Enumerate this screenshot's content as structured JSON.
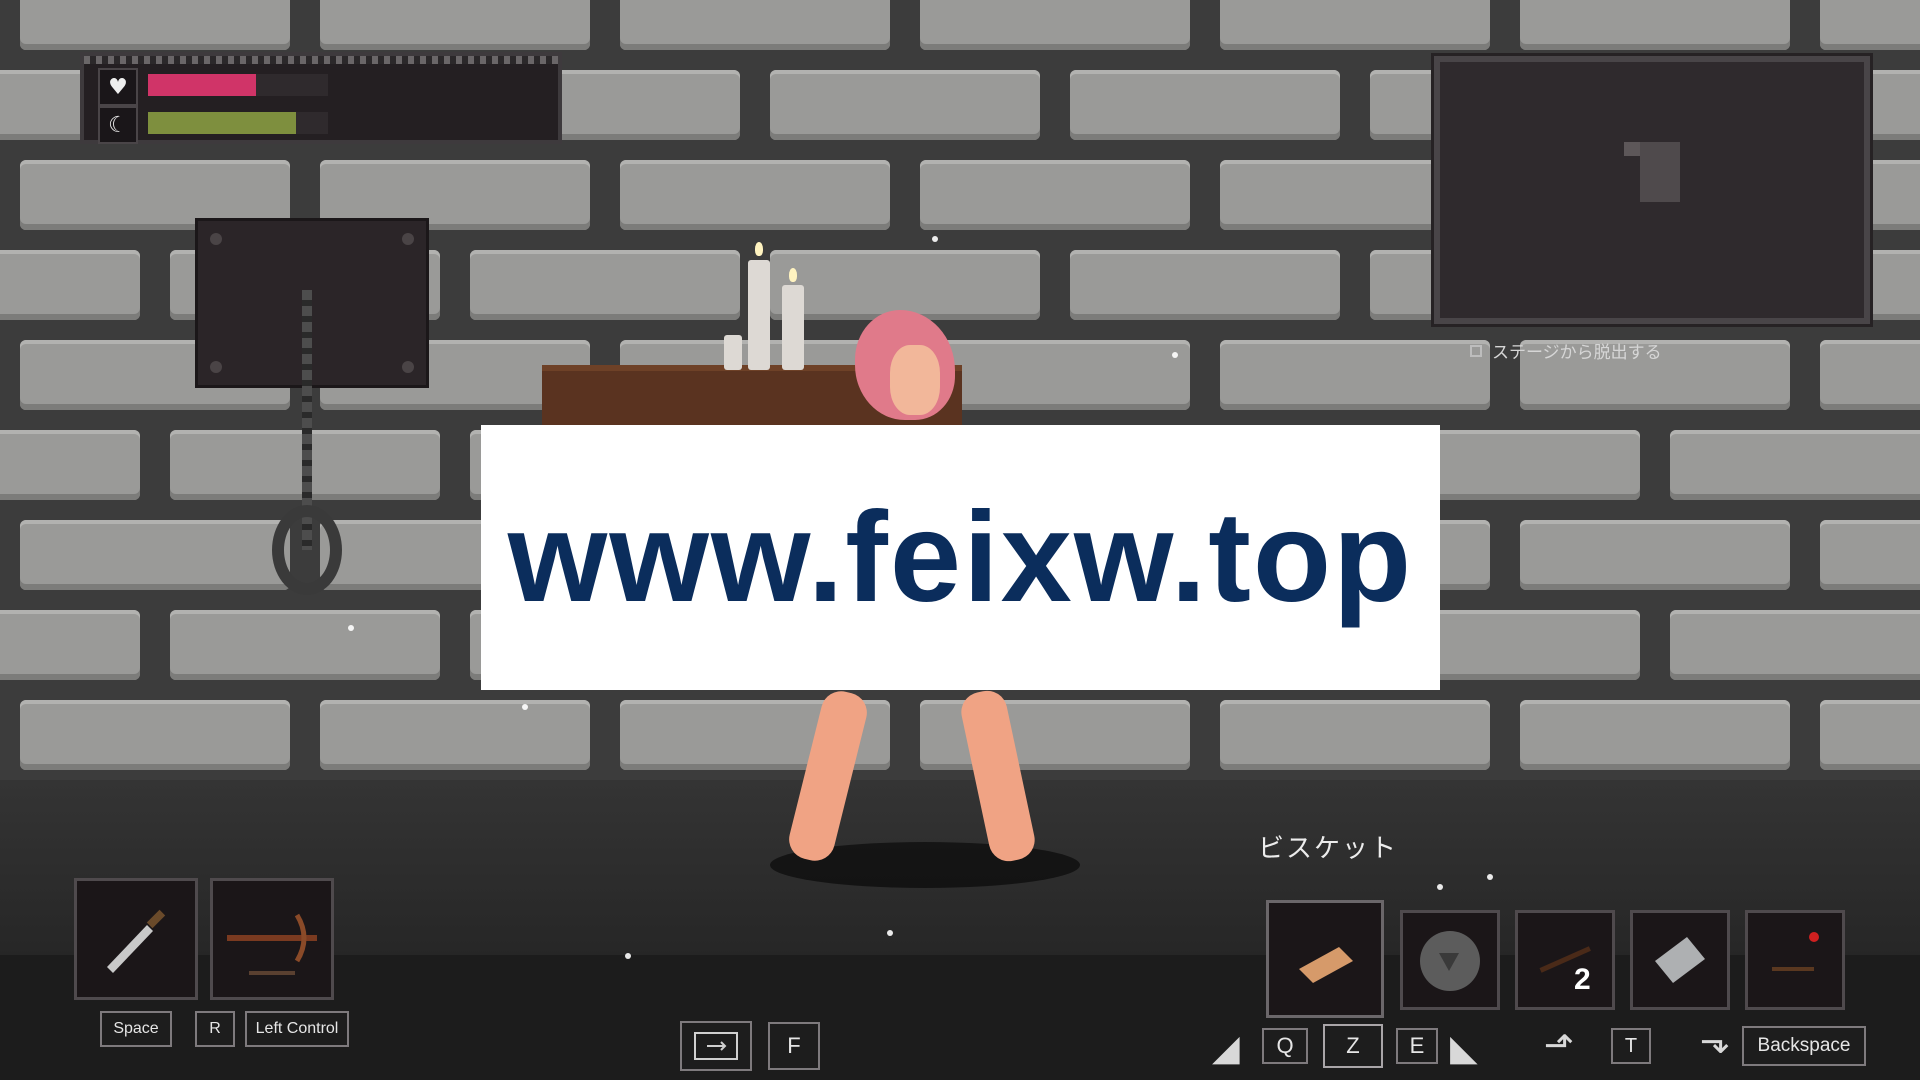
{
  "hud": {
    "health": {
      "icon": "heart-icon",
      "fraction": 0.6,
      "color": "#d03468"
    },
    "stamina": {
      "icon": "moon-icon",
      "fraction": 0.82,
      "color": "#7e8f3e"
    },
    "escape_label": "ステージから脱出する"
  },
  "watermark": {
    "text": "www.feixw.top"
  },
  "weapons": [
    {
      "icon": "dagger-icon",
      "key": "Space"
    },
    {
      "icon": "crossbow-icon",
      "key": "R"
    }
  ],
  "weapon_extra_key": "Left Control",
  "center_keys": {
    "map_icon": "map-icon",
    "interact_key": "F"
  },
  "items": {
    "selected_name": "ビスケット",
    "slots": [
      {
        "icon": "biscuit-icon",
        "count": ""
      },
      {
        "icon": "rock-icon",
        "count": ""
      },
      {
        "icon": "stick-icon",
        "count": "2"
      },
      {
        "icon": "gauze-icon",
        "count": ""
      },
      {
        "icon": "trap-icon",
        "count": ""
      }
    ],
    "keys": {
      "prev": "Q",
      "use": "Z",
      "next": "E",
      "throw": "T",
      "drop": "Backspace"
    }
  }
}
